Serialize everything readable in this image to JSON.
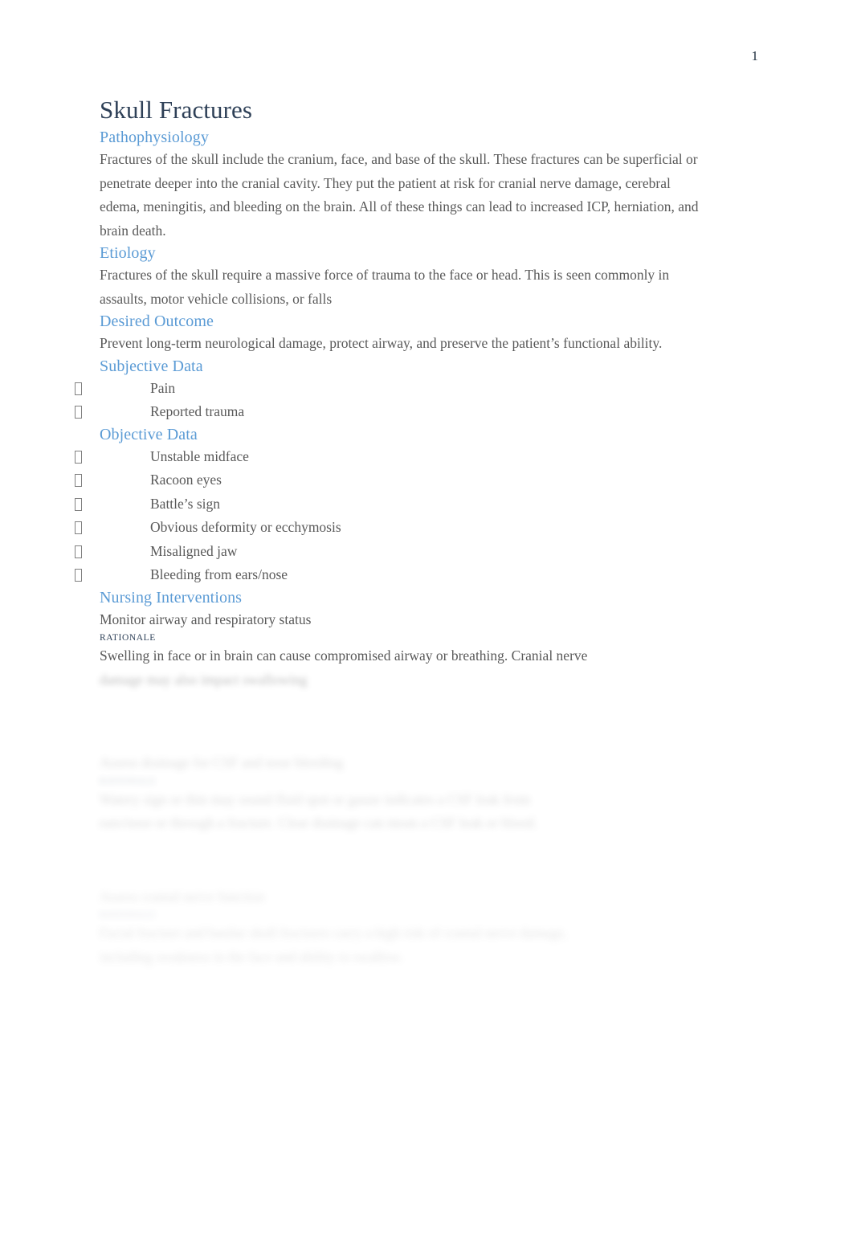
{
  "document": {
    "page_number": "1",
    "title": "Skull Fractures"
  },
  "colors": {
    "title": "#2e4057",
    "heading": "#5b9bd5",
    "body": "#595959",
    "rationale_label": "#31435a",
    "page_background": "#ffffff"
  },
  "sections": {
    "pathophysiology": {
      "heading": "Pathophysiology",
      "body": "Fractures of the skull include the cranium, face, and base of the skull. These fractures can be superficial or penetrate deeper into the cranial cavity. They put the patient at risk for cranial nerve damage, cerebral edema, meningitis, and bleeding on the brain. All of these things can lead to increased ICP, herniation, and brain death."
    },
    "etiology": {
      "heading": "Etiology",
      "body": "Fractures of the skull require a massive force of trauma to the face or head. This is seen commonly in assaults, motor vehicle collisions, or falls"
    },
    "desired_outcome": {
      "heading": "Desired Outcome",
      "body": "Prevent long-term neurological damage, protect airway, and preserve the patient’s functional ability."
    },
    "subjective_data": {
      "heading": "Subjective Data",
      "items": [
        "Pain",
        "Reported trauma"
      ]
    },
    "objective_data": {
      "heading": "Objective Data",
      "items": [
        "Unstable midface",
        "Racoon eyes",
        "Battle’s sign",
        "Obvious deformity or ecchymosis",
        "Misaligned jaw",
        "Bleeding from ears/nose"
      ]
    },
    "nursing_interventions": {
      "heading": "Nursing Interventions",
      "rationale_label": "RATIONALE",
      "interventions": [
        {
          "action": "Monitor airway and respiratory status",
          "rationale_label": "RATIONALE",
          "rationale_visible": "Swelling in face or in brain can cause compromised airway or breathing. Cranial nerve",
          "rationale_blurred": "damage may also impact swallowing"
        },
        {
          "action": "Assess drainage for CSF and nose bleeding",
          "rationale_label": "RATIONALE",
          "rationale_line1": "Watery sign or thin may sound fluid spot or gauze indicates a CSF leak from",
          "rationale_line2": "ears/nose or through a fracture. Clear drainage can mean a CSF leak or blood."
        },
        {
          "action": "Assess cranial nerve function",
          "rationale_label": "RATIONALE",
          "rationale_line1": "Facial fracture and basilar skull fractures carry a high risk of cranial nerve damage,",
          "rationale_line2": "including weakness in the face and ability to swallow."
        }
      ]
    }
  }
}
